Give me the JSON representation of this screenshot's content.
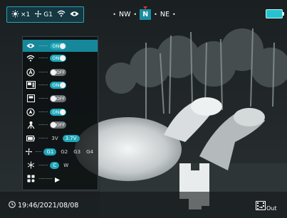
{
  "status_bar": {
    "brightness_value": "×1",
    "fan_mode": "G1"
  },
  "compass": {
    "left_label": "NW",
    "center_label": "N",
    "right_label": "NE",
    "separator": "•"
  },
  "menu": {
    "rows": [
      {
        "icon": "eye-icon",
        "state": "ON"
      },
      {
        "icon": "wifi-icon",
        "state": "ON"
      },
      {
        "icon": "auto-icon",
        "state": "OFF"
      },
      {
        "icon": "picture-in-picture-icon",
        "state": "ON"
      },
      {
        "icon": "display-icon",
        "state": "OFF"
      },
      {
        "icon": "navigation-icon",
        "state": "ON"
      },
      {
        "icon": "tripod-icon",
        "state": "OFF"
      }
    ],
    "voltage": {
      "options": [
        "3V",
        "3.7V"
      ],
      "selected": "3.7V"
    },
    "fan": {
      "options": [
        "G1",
        "G2",
        "G3",
        "G4"
      ],
      "selected": "G1"
    },
    "temperature_unit": {
      "options": [
        "C",
        "W"
      ],
      "selected": "C"
    }
  },
  "datetime": "19:46/2021/08/08",
  "exit_label": "Out",
  "colors": {
    "accent": "#1fa6b8",
    "toggle_off": "#6a7074"
  }
}
